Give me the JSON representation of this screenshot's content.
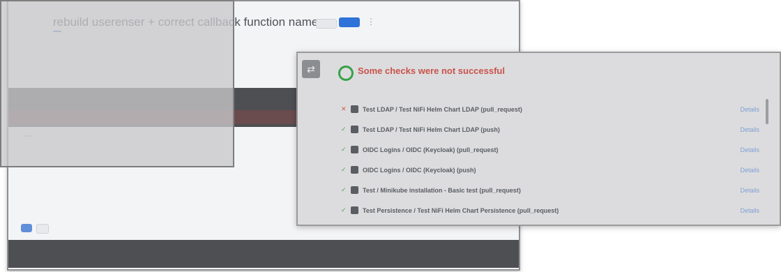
{
  "top_banner": {
    "text": ""
  },
  "pr_page": {
    "title": "rebuild userenser + correct callback function name",
    "crumbs": "",
    "status_badge": "",
    "author": "",
    "meta_text": "",
    "meta_link": "",
    "edit_label": "",
    "code_label": "",
    "tabs": [
      {
        "label": ""
      },
      {
        "label": ""
      },
      {
        "label": ""
      },
      {
        "label": ""
      }
    ],
    "file_path": "",
    "diff_lines": [
      "",
      ""
    ],
    "review_label": "",
    "review_pill": "",
    "write_tab": "",
    "preview_tab": "",
    "comment": "",
    "markdown_note": "",
    "buttons": {
      "primary": "",
      "secondary": "",
      "cancel": ""
    },
    "code_line": ""
  },
  "checks": {
    "headline": "Some checks were not successful",
    "subtitle": "",
    "hide_label": "",
    "items": [
      {
        "status": "fail",
        "name": "Test LDAP / Test NiFi Helm Chart LDAP (pull_request)",
        "desc": "",
        "details": "Details"
      },
      {
        "status": "pass",
        "name": "Test LDAP / Test NiFi Helm Chart LDAP (push)",
        "desc": "",
        "details": "Details"
      },
      {
        "status": "pass",
        "name": "OIDC Logins / OIDC (Keycloak) (pull_request)",
        "desc": "",
        "details": "Details"
      },
      {
        "status": "pass",
        "name": "OIDC Logins / OIDC (Keycloak) (push)",
        "desc": "",
        "details": "Details"
      },
      {
        "status": "pass",
        "name": "Test / Minikube installation - Basic test (pull_request)",
        "desc": "",
        "details": "Details"
      },
      {
        "status": "pass",
        "name": "Test Persistence / Test NiFi Helm Chart Persistence (pull_request)",
        "desc": "",
        "details": "Details"
      }
    ]
  },
  "icons": {
    "fail": "cross-icon",
    "pass": "check-icon",
    "merge": "merge-icon"
  },
  "colors": {
    "green_text": "#3cb043",
    "fail": "#c9524a",
    "link": "#7f9fd3",
    "accent_tab": "#e3803a"
  }
}
